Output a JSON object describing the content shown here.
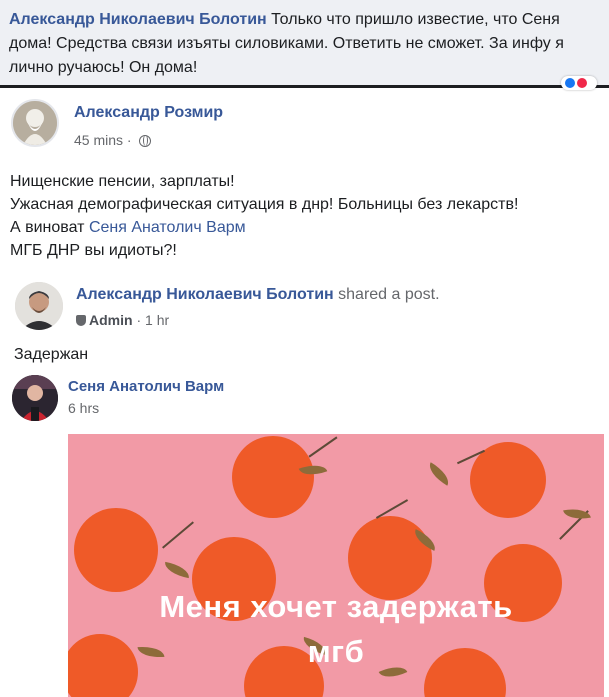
{
  "top_comment": {
    "author": "Александр Николаевич Болотин",
    "text": "Только что пришло известие, что Сеня дома! Средства связи изъяты силовиками. Ответить не сможет. За инфу я лично ручаюсь! Он дома!"
  },
  "post": {
    "author": "Александр Розмир",
    "time": "45 mins",
    "lines": [
      "Нищенские пенсии, зарплаты!",
      "Ужасная демографическая ситуация в днр! Больницы без лекарств!",
      "А виноват",
      "Сеня Анатолич Варм",
      "МГБ ДНР вы идиоты?!"
    ]
  },
  "shared": {
    "author": "Александр Николаевич Болотин",
    "action": "shared a post.",
    "role": "Admin",
    "time": "1 hr",
    "text": "Задержан"
  },
  "original": {
    "author": "Сеня Анатолич Варм",
    "time": "6 hrs",
    "image_text_line1": "Меня хочет задержать",
    "image_text_line2": "мгб"
  },
  "colors": {
    "link": "#385898",
    "image_background": "#f29aa6",
    "orange": "#ef5a28"
  }
}
